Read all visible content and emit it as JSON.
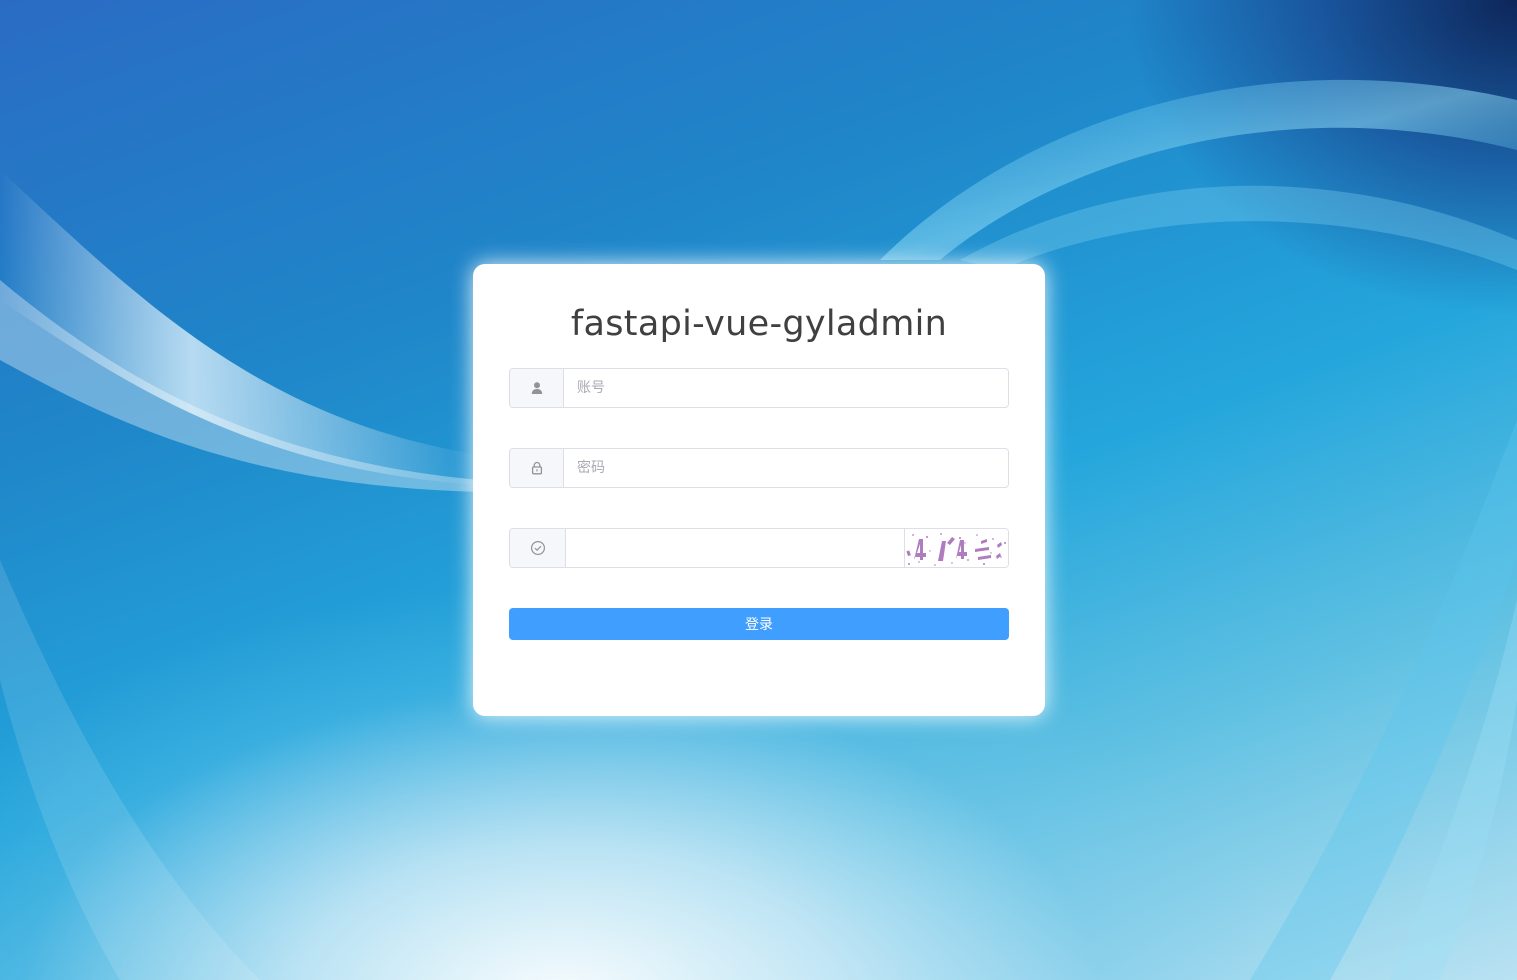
{
  "login": {
    "title": "fastapi-vue-gyladmin",
    "username": {
      "placeholder": "账号",
      "value": "",
      "icon": "user-icon"
    },
    "password": {
      "placeholder": "密码",
      "value": "",
      "icon": "lock-icon"
    },
    "captcha": {
      "placeholder": "",
      "value": "",
      "icon": "circle-check-icon",
      "image_text": "4#4",
      "image_color": "#b07cc0"
    },
    "submit_label": "登录"
  },
  "colors": {
    "primary": "#409eff",
    "card_bg": "#ffffff",
    "border": "#dcdfe6",
    "addon_bg": "#f5f7fa"
  }
}
